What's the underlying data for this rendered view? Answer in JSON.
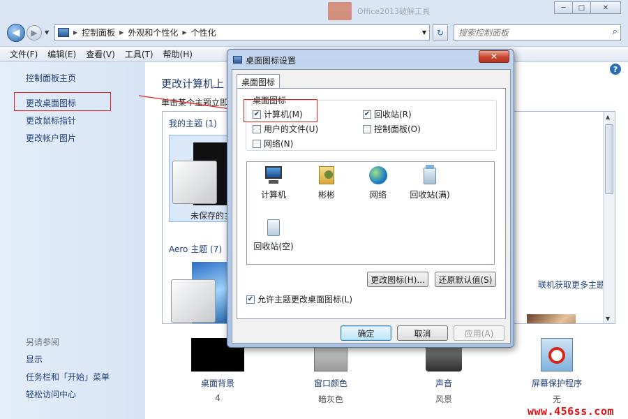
{
  "window": {
    "ghost_title": "Office2013破解工具",
    "controls": {
      "minimize": "─",
      "maximize": "□",
      "close": "✕"
    }
  },
  "navbar": {
    "breadcrumbs": [
      "控制面板",
      "外观和个性化",
      "个性化"
    ],
    "search_placeholder": "搜索控制面板"
  },
  "menu": [
    "文件(F)",
    "编辑(E)",
    "查看(V)",
    "工具(T)",
    "帮助(H)"
  ],
  "sidebar": {
    "links": [
      "控制面板主页",
      "更改桌面图标",
      "更改鼠标指针",
      "更改帐户图片"
    ],
    "see_also_title": "另请参阅",
    "see_also": [
      "显示",
      "任务栏和「开始」菜单",
      "轻松访问中心"
    ]
  },
  "main": {
    "title": "更改计算机上",
    "subtitle": "单击某个主题立即",
    "my_themes": "我的主题 (1)",
    "unsaved_theme": "未保存的主",
    "aero_themes": "Aero 主题 (7)",
    "online_link": "联机获取更多主题",
    "bottom": [
      {
        "label": "桌面背景",
        "value": "4"
      },
      {
        "label": "窗口颜色",
        "value": "暗灰色"
      },
      {
        "label": "声音",
        "value": "风景"
      },
      {
        "label": "屏幕保护程序",
        "value": "无"
      }
    ]
  },
  "dialog": {
    "title": "桌面图标设置",
    "tab": "桌面图标",
    "group_title": "桌面图标",
    "checkboxes": [
      {
        "label": "计算机(M)",
        "checked": true
      },
      {
        "label": "回收站(R)",
        "checked": true
      },
      {
        "label": "用户的文件(U)",
        "checked": false
      },
      {
        "label": "控制面板(O)",
        "checked": false
      },
      {
        "label": "网络(N)",
        "checked": false
      }
    ],
    "icons": [
      "计算机",
      "彬彬",
      "网络",
      "回收站(满)",
      "回收站(空)"
    ],
    "change_icon_button": "更改图标(H)...",
    "restore_default_button": "还原默认值(S)",
    "allow_themes_label": "允许主题更改桌面图标(L)",
    "allow_themes_checked": true,
    "ok": "确定",
    "cancel": "取消",
    "apply": "应用(A)"
  },
  "watermark": "www.456ss.com"
}
